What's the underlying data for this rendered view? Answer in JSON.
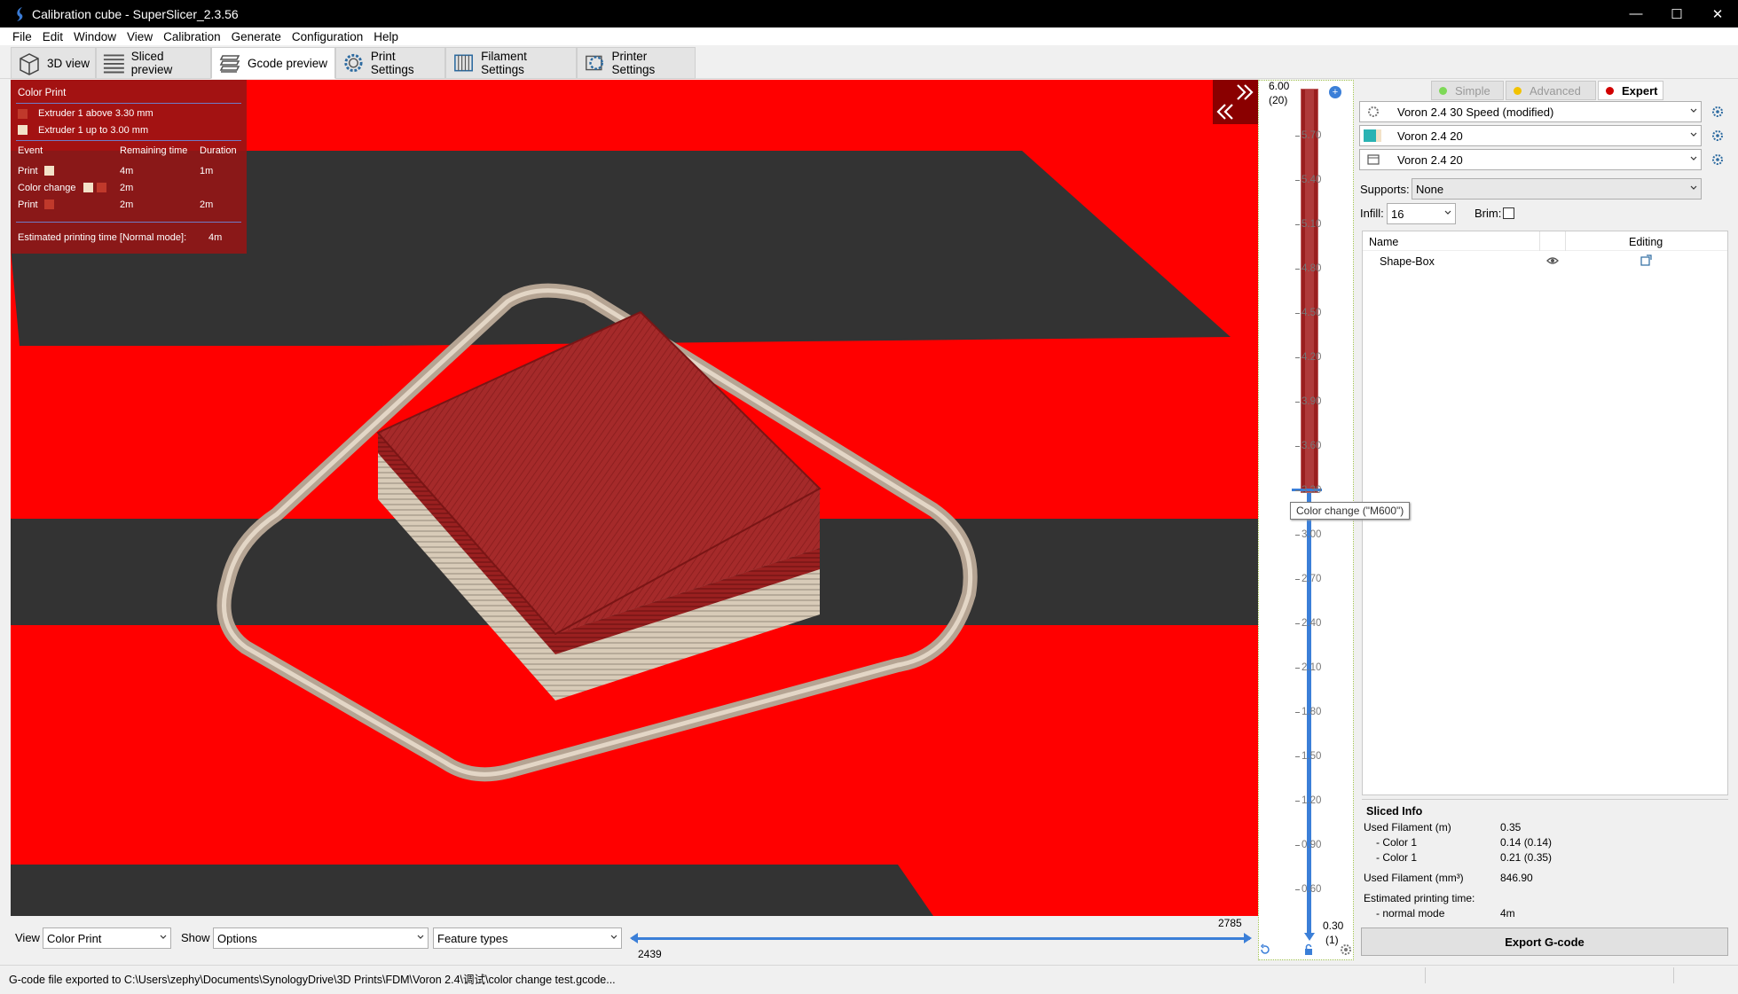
{
  "window": {
    "title": "Calibration cube - SuperSlicer_2.3.56",
    "minimize": "—",
    "maximize": "☐",
    "close": "✕"
  },
  "menu": [
    "File",
    "Edit",
    "Window",
    "View",
    "Calibration",
    "Generate",
    "Configuration",
    "Help"
  ],
  "tabs": [
    {
      "label": "3D view",
      "icon": "cube-icon"
    },
    {
      "label": "Sliced preview",
      "icon": "layers-icon"
    },
    {
      "label": "Gcode preview",
      "icon": "gcode-icon"
    },
    {
      "label": "Print Settings",
      "icon": "gear-icon"
    },
    {
      "label": "Filament Settings",
      "icon": "spool-icon"
    },
    {
      "label": "Printer Settings",
      "icon": "printer-gear-icon"
    }
  ],
  "legend": {
    "title": "Color Print",
    "extruders": [
      {
        "label": "Extruder 1 above 3.30 mm",
        "color": "#c0392b"
      },
      {
        "label": "Extruder 1 up to 3.00 mm",
        "color": "#f3e2c8"
      }
    ],
    "headers": {
      "event": "Event",
      "remaining": "Remaining time",
      "duration": "Duration"
    },
    "rows": [
      {
        "event": "Print",
        "remaining": "4m",
        "duration": "1m"
      },
      {
        "event": "Color change",
        "remaining": "2m",
        "duration": ""
      },
      {
        "event": "Print",
        "remaining": "2m",
        "duration": "2m"
      }
    ],
    "estimate_label": "Estimated printing time [Normal mode]:",
    "estimate_value": "4m"
  },
  "layer_slider": {
    "top_value": "6.00",
    "top_layer": "(20)",
    "ticks": [
      "5.70",
      "5.40",
      "5.10",
      "4.80",
      "4.50",
      "4.20",
      "3.90",
      "3.60",
      "3.30",
      "3.00",
      "2.70",
      "2.40",
      "2.10",
      "1.80",
      "1.50",
      "1.20",
      "0.90",
      "0.60"
    ],
    "bottom_value": "0.30",
    "bottom_layer": "(1)",
    "tooltip": "Color change (\"M600\")"
  },
  "bottom": {
    "view_label": "View",
    "view_value": "Color Print",
    "show_label": "Show",
    "show_value": "Options",
    "feature_value": "Feature types",
    "h_max": "2785",
    "h_min": "2439"
  },
  "right": {
    "modes": {
      "simple": "Simple",
      "advanced": "Advanced",
      "expert": "Expert"
    },
    "print_profile": "Voron 2.4 30 Speed (modified)",
    "filament_profile": "Voron 2.4 20",
    "printer_profile": "Voron 2.4 20",
    "supports_label": "Supports:",
    "supports_value": "None",
    "infill_label": "Infill:",
    "infill_value": "16",
    "brim_label": "Brim:",
    "list_headers": {
      "name": "Name",
      "editing": "Editing"
    },
    "objects": [
      {
        "name": "Shape-Box"
      }
    ],
    "sliced_info": {
      "title": "Sliced Info",
      "used_filament_m_label": "Used Filament (m)",
      "used_filament_m": "0.35",
      "color1_label": "- Color 1",
      "color1_val": "0.14 (0.14)",
      "color1b_label": "- Color 1",
      "color1b_val": "0.21 (0.35)",
      "used_filament_mm3_label": "Used Filament (mm³)",
      "used_filament_mm3": "846.90",
      "est_label": "Estimated printing time:",
      "normal_label": "- normal mode",
      "normal_val": "4m"
    },
    "export": "Export G-code"
  },
  "status": "G-code file exported to C:\\Users\\zephy\\Documents\\SynologyDrive\\3D Prints\\FDM\\Voron 2.4\\调试\\color change test.gcode..."
}
